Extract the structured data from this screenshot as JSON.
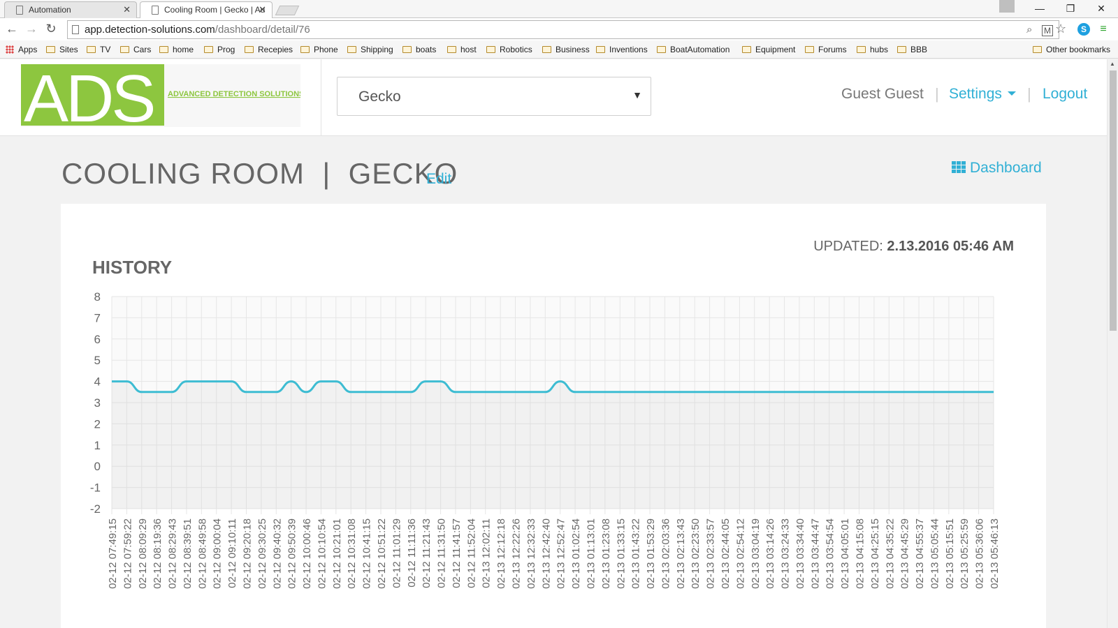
{
  "browser": {
    "tabs": [
      {
        "title": "Automation",
        "active": false
      },
      {
        "title": "Cooling Room | Gecko | Au",
        "active": true
      }
    ],
    "url": {
      "host": "app.detection-solutions.com",
      "path": "/dashboard/detail/76"
    },
    "bookmarks": [
      "Sites",
      "TV",
      "Cars",
      "home",
      "Prog",
      "Recepies",
      "Phone",
      "Shipping",
      "boats",
      "host",
      "Robotics",
      "Business",
      "Inventions",
      "BoatAutomation",
      "Equipment",
      "Forums",
      "hubs",
      "BBB"
    ],
    "apps_label": "Apps",
    "other_bookmarks": "Other bookmarks"
  },
  "header": {
    "logo_letters": "ADS",
    "logo_tagline": "ADVANCED DETECTION SOLUTIONS",
    "device_select": "Gecko",
    "user": "Guest Guest",
    "settings": "Settings",
    "logout": "Logout"
  },
  "page": {
    "title": "COOLING ROOM  |  GECKO",
    "edit": "Edit",
    "dashboard": "Dashboard",
    "updated_label": "UPDATED:",
    "updated_value": "2.13.2016 05:46 AM",
    "history": "HISTORY"
  },
  "colors": {
    "accent": "#31b0d5",
    "line": "#3dbcd2",
    "logo_green": "#8dc63f"
  },
  "chart_data": {
    "type": "line",
    "title": "HISTORY",
    "ylim": [
      -2,
      8
    ],
    "yticks": [
      "8",
      "7",
      "6",
      "5",
      "4",
      "3",
      "2",
      "1",
      "0",
      "-1",
      "-2"
    ],
    "x": [
      "02-12 07:49:15",
      "02-12 07:59:22",
      "02-12 08:09:29",
      "02-12 08:19:36",
      "02-12 08:29:43",
      "02-12 08:39:51",
      "02-12 08:49:58",
      "02-12 09:00:04",
      "02-12 09:10:11",
      "02-12 09:20:18",
      "02-12 09:30:25",
      "02-12 09:40:32",
      "02-12 09:50:39",
      "02-12 10:00:46",
      "02-12 10:10:54",
      "02-12 10:21:01",
      "02-12 10:31:08",
      "02-12 10:41:15",
      "02-12 10:51:22",
      "02-12 11:01:29",
      "02-12 11:11:36",
      "02-12 11:21:43",
      "02-12 11:31:50",
      "02-12 11:41:57",
      "02-12 11:52:04",
      "02-13 12:02:11",
      "02-13 12:12:18",
      "02-13 12:22:26",
      "02-13 12:32:33",
      "02-13 12:42:40",
      "02-13 12:52:47",
      "02-13 01:02:54",
      "02-13 01:13:01",
      "02-13 01:23:08",
      "02-13 01:33:15",
      "02-13 01:43:22",
      "02-13 01:53:29",
      "02-13 02:03:36",
      "02-13 02:13:43",
      "02-13 02:23:50",
      "02-13 02:33:57",
      "02-13 02:44:05",
      "02-13 02:54:12",
      "02-13 03:04:19",
      "02-13 03:14:26",
      "02-13 03:24:33",
      "02-13 03:34:40",
      "02-13 03:44:47",
      "02-13 03:54:54",
      "02-13 04:05:01",
      "02-13 04:15:08",
      "02-13 04:25:15",
      "02-13 04:35:22",
      "02-13 04:45:29",
      "02-13 04:55:37",
      "02-13 05:05:44",
      "02-13 05:15:51",
      "02-13 05:25:59",
      "02-13 05:36:06",
      "02-13 05:46:13"
    ],
    "series": [
      {
        "values": [
          4.0,
          4.0,
          3.5,
          3.5,
          3.5,
          4.0,
          4.0,
          4.0,
          4.0,
          3.5,
          3.5,
          3.5,
          4.0,
          3.5,
          4.0,
          4.0,
          3.5,
          3.5,
          3.5,
          3.5,
          3.5,
          4.0,
          4.0,
          3.5,
          3.5,
          3.5,
          3.5,
          3.5,
          3.5,
          3.5,
          4.0,
          3.5,
          3.5,
          3.5,
          3.5,
          3.5,
          3.5,
          3.5,
          3.5,
          3.5,
          3.5,
          3.5,
          3.5,
          3.5,
          3.5,
          3.5,
          3.5,
          3.5,
          3.5,
          3.5,
          3.5,
          3.5,
          3.5,
          3.5,
          3.5,
          3.5,
          3.5,
          3.5,
          3.5,
          3.5
        ]
      }
    ],
    "grid": true
  }
}
